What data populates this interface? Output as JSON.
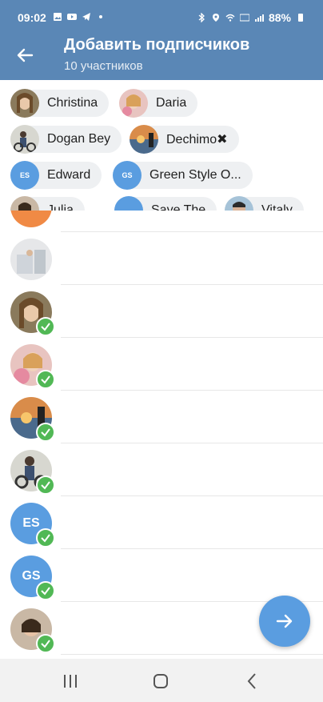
{
  "status_bar": {
    "time": "09:02",
    "battery": "88%",
    "left_icons": [
      "gallery-icon",
      "youtube-icon",
      "telegram-icon",
      "dot-icon"
    ],
    "right_icons": [
      "bluetooth-icon",
      "location-icon",
      "wifi-icon",
      "volte-icon",
      "signal-icon",
      "battery-icon"
    ]
  },
  "header": {
    "title": "Добавить подписчиков",
    "subtitle": "10 участников"
  },
  "chips": [
    {
      "name": "Christina"
    },
    {
      "name": "Daria"
    },
    {
      "name": "Dogan Bey"
    },
    {
      "name": "Dechimo✖"
    },
    {
      "name": "Edward",
      "initials": "ES"
    },
    {
      "name": "Green Style O...",
      "initials": "GS"
    },
    {
      "name": "Julia"
    },
    {
      "name": "Save The"
    },
    {
      "name": "Vitaly"
    }
  ],
  "list": [
    {
      "initials": ""
    },
    {
      "initials": ""
    },
    {
      "initials": ""
    },
    {
      "initials": ""
    },
    {
      "initials": ""
    },
    {
      "initials": ""
    },
    {
      "initials": "ES"
    },
    {
      "initials": "GS"
    },
    {
      "initials": ""
    }
  ],
  "colors": {
    "header": "#5a87b6",
    "accent": "#5a9de0",
    "check": "#51b855",
    "chip_bg": "#eef0f2"
  }
}
